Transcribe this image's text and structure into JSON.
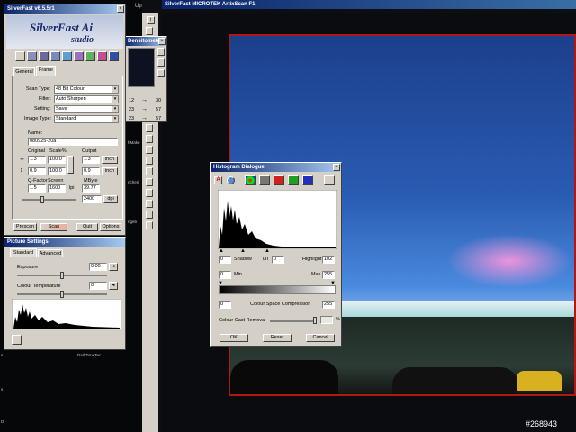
{
  "desktop": {
    "icons_text": [
      "DarkToneTec",
      "ncheri",
      "ngeb",
      "hMake"
    ],
    "watermark": "#268943",
    "mid_top": "Uploa",
    "left_marks": [
      "s",
      "s",
      "D"
    ]
  },
  "scan_window": {
    "title": "SilverFast MICROTEK ArtixScan F1",
    "toolbar_top": "i"
  },
  "main_window": {
    "title": "SilverFast v6.5.5r1",
    "logo_line1": "SilverFast Ai",
    "logo_line2": "studio",
    "tabs": [
      "General",
      "Frame"
    ],
    "scan_type_label": "Scan Type:",
    "scan_type": "48 Bit Colour",
    "filter_label": "Filter:",
    "filter": "Auto Sharpen",
    "setting_label": "Setting:",
    "setting": "Save",
    "image_type_label": "Image Type:",
    "image_type": "Standard",
    "name_label": "Name:",
    "name": "080925-20a",
    "original_label": "Original",
    "scale_label": "Scale%",
    "output_label": "Output",
    "orig_w": "1.3",
    "scale": "100.0",
    "out_w": "1.3",
    "unit1": "inch",
    "orig_h": "0.9",
    "scale_h": "100.0",
    "out_h": "0.9",
    "unit2": "inch",
    "qfactor_label": "Q-Factor",
    "screen_label": "Screen",
    "mbyte_label": "MByte",
    "qfactor": "1.5",
    "screen": "1600",
    "lpi": "lpi",
    "mbyte": "39.77",
    "dpi_value": "2400",
    "dpi": "dpi",
    "buttons": [
      "Prescan",
      "Scan",
      "Quit",
      "Options"
    ]
  },
  "densito": {
    "title": "Densitometer",
    "rows": [
      [
        "12",
        "30"
      ],
      [
        "23",
        "57"
      ],
      [
        "23",
        "57"
      ]
    ]
  },
  "picture_settings": {
    "title": "Picture Settings",
    "tabs": [
      "Standard",
      "Advanced"
    ],
    "exposure_label": "Exposure",
    "exposure": "0.00",
    "colour_temp_label": "Colour Temperature",
    "colour_temp": "0"
  },
  "histogram": {
    "title": "Histogram Dialogue",
    "shadow_label": "Shadow",
    "shadow_val": "0",
    "mid_label": "I/II",
    "mid_val": "0",
    "highlight_label": "Highlight",
    "highlight_val": "102",
    "min_val": "0",
    "min_label": "Min",
    "max_label": "Max",
    "max_val": "255",
    "csc_left": "0",
    "csc_label": "Colour Space Compression",
    "csc_right": "255",
    "ccr_label": "Colour Cast Removal",
    "pct": "%",
    "buttons": [
      "OK",
      "Reset",
      "Cancel"
    ]
  }
}
